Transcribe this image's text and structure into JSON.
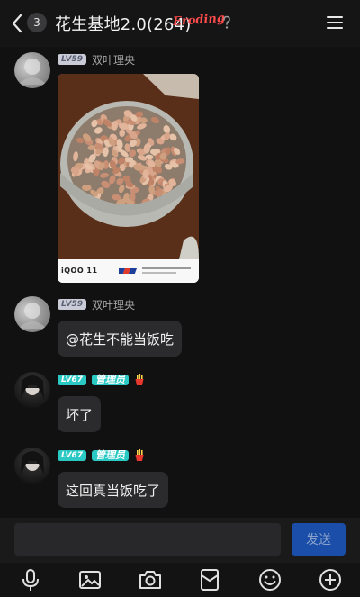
{
  "header": {
    "unread_count": "3",
    "title": "花生基地2.0(264)",
    "brand_text": "Eroding"
  },
  "messages": [
    {
      "level": "LV59",
      "name": "双叶理央",
      "type": "image",
      "camera": "iQOO 11"
    },
    {
      "level": "LV59",
      "name": "双叶理央",
      "text": "@花生不能当饭吃"
    },
    {
      "level": "LV67",
      "role": "管理员",
      "text": "坏了"
    },
    {
      "level": "LV67",
      "role": "管理员",
      "text": "这回真当饭吃了"
    }
  ],
  "composer": {
    "input_value": "",
    "send_label": "发送"
  },
  "toolbar": [
    "microphone-icon",
    "image-icon",
    "camera-icon",
    "red-packet-icon",
    "emoji-icon",
    "plus-icon"
  ],
  "colors": {
    "accent_send": "#1a4ea8",
    "admin_badge": "#2bc9c4",
    "brand": "#ff4b4b"
  }
}
